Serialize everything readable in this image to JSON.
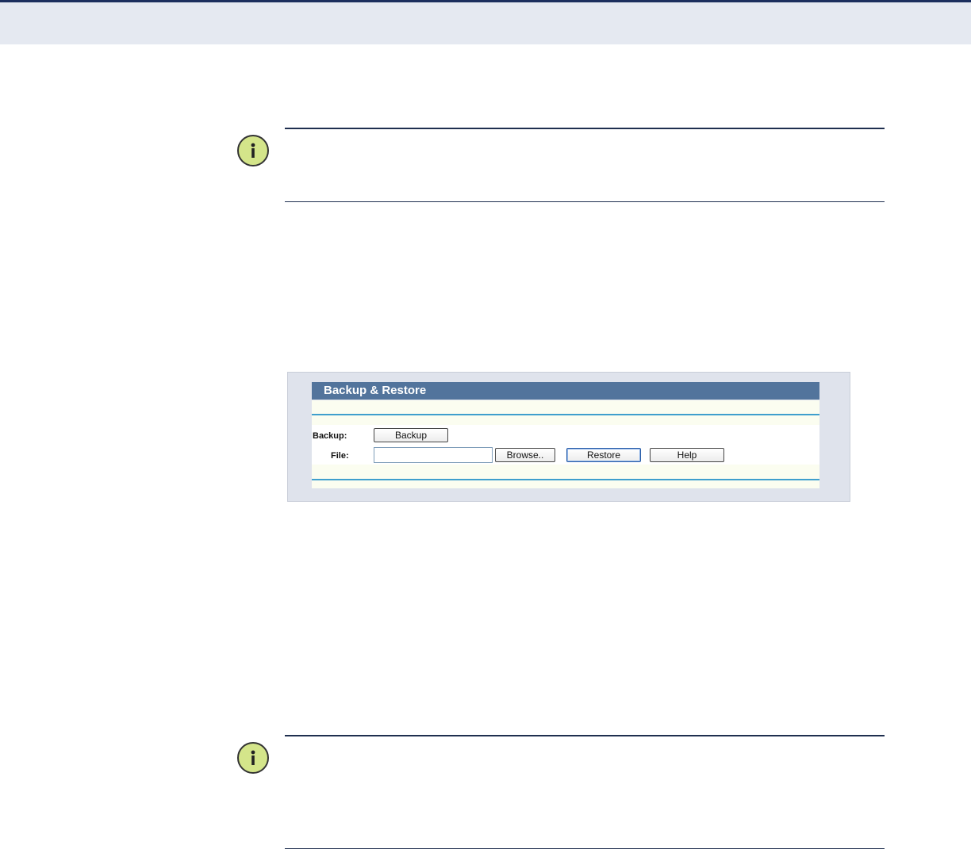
{
  "notes": [
    {
      "icon": "info-icon"
    },
    {
      "icon": "info-icon"
    }
  ],
  "panel": {
    "title": "Backup & Restore",
    "backup_label": "Backup:",
    "backup_button": "Backup",
    "file_label": "File:",
    "file_value": "",
    "browse_button": "Browse..",
    "restore_button": "Restore",
    "help_button": "Help"
  },
  "colors": {
    "title_bar": "#52749c",
    "header_band": "#e5e9f1",
    "header_rule": "#1c2f5e",
    "strip_line": "#3f9fcd",
    "note_icon_fill": "#d4e58a"
  }
}
